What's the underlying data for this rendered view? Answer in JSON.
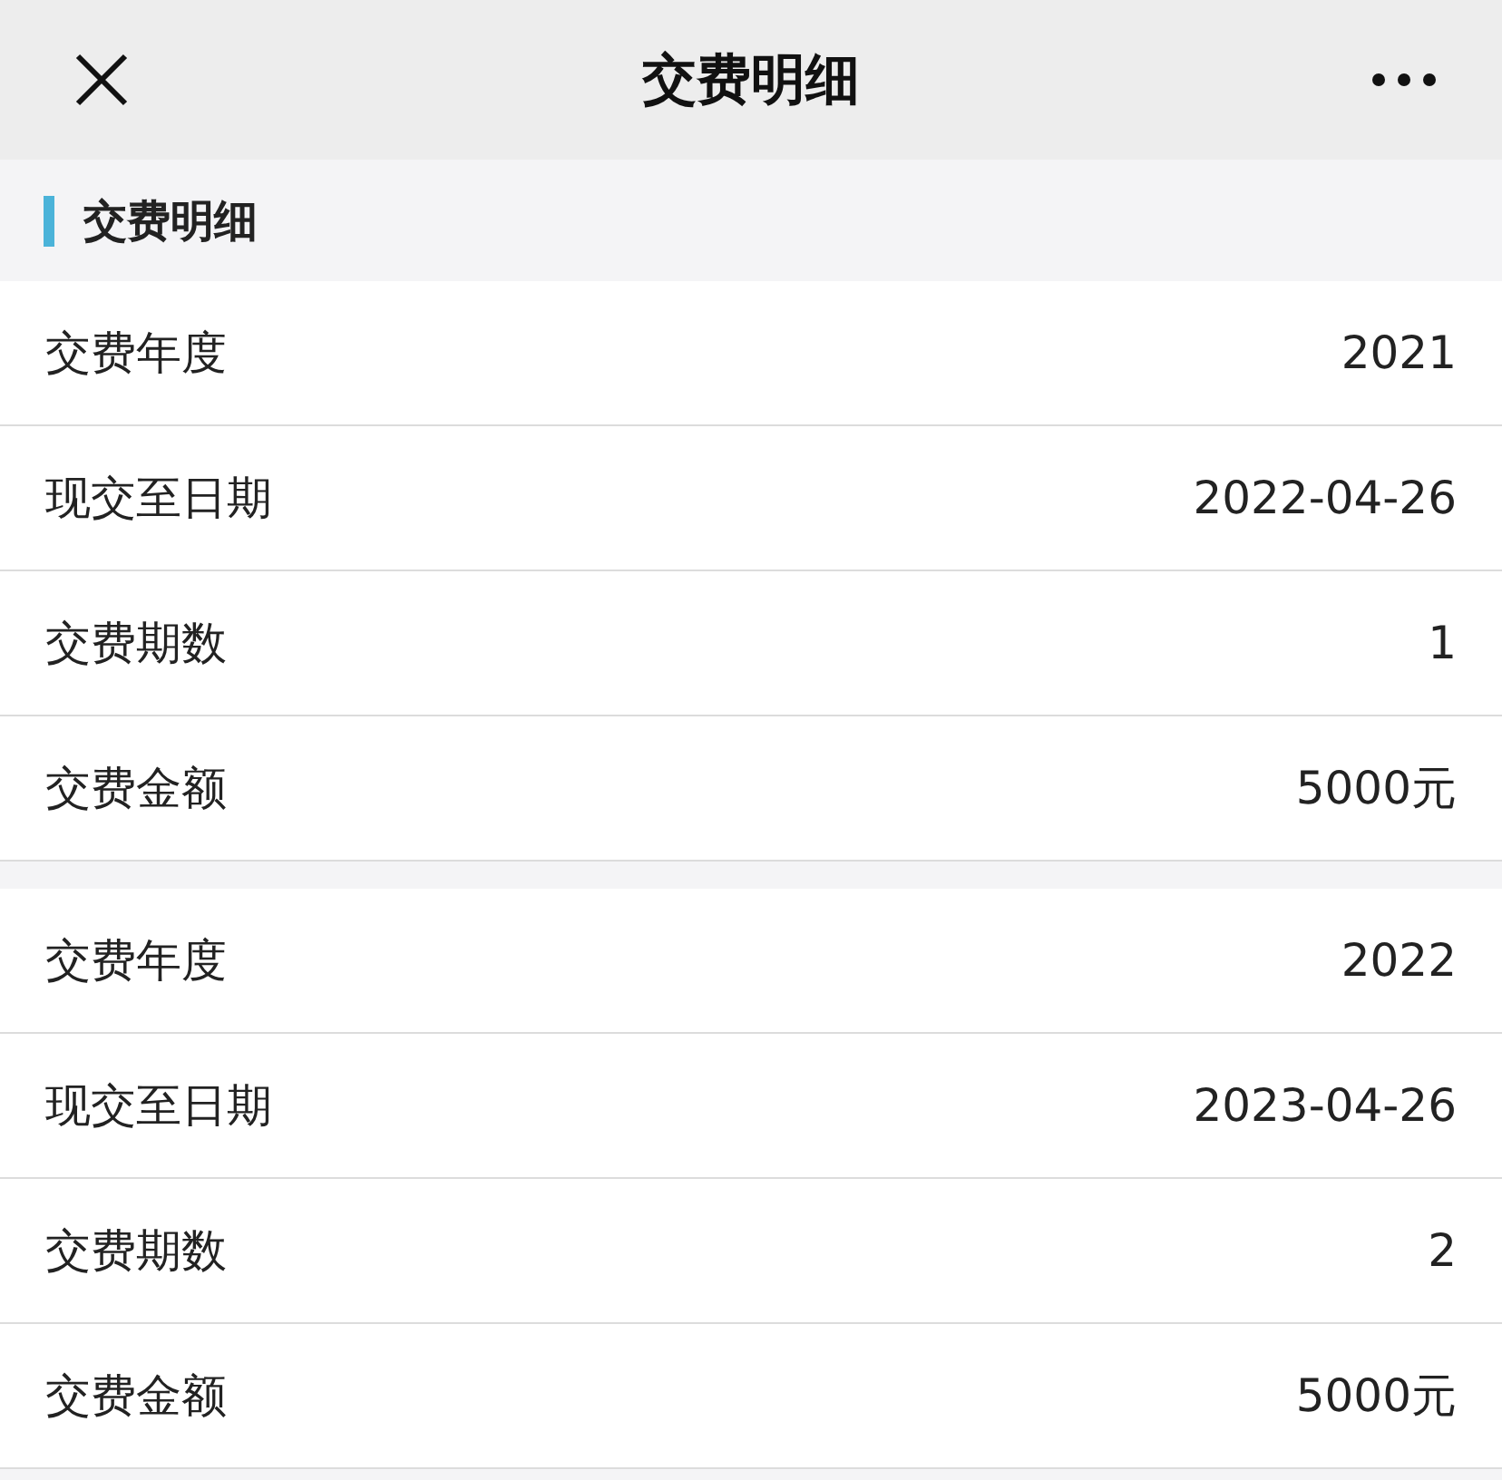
{
  "header": {
    "title": "交费明细"
  },
  "section": {
    "title": "交费明细"
  },
  "groups": [
    {
      "rows": [
        {
          "label": "交费年度",
          "value": "2021"
        },
        {
          "label": "现交至日期",
          "value": "2022-04-26"
        },
        {
          "label": "交费期数",
          "value": "1"
        },
        {
          "label": "交费金额",
          "value": "5000元"
        }
      ]
    },
    {
      "rows": [
        {
          "label": "交费年度",
          "value": "2022"
        },
        {
          "label": "现交至日期",
          "value": "2023-04-26"
        },
        {
          "label": "交费期数",
          "value": "2"
        },
        {
          "label": "交费金额",
          "value": "5000元"
        }
      ]
    }
  ]
}
